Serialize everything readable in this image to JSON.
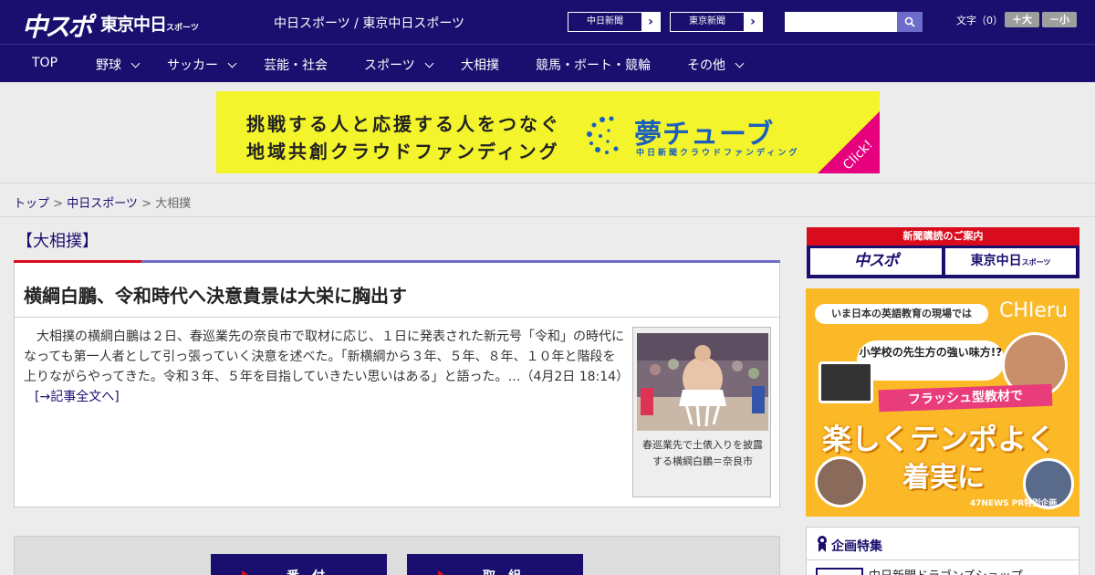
{
  "header": {
    "logo_chuspo": "中スポ",
    "logo_tokyo": "東京中日",
    "logo_tokyo_small": "スポーツ",
    "site_links": "中日スポーツ / 東京中日スポーツ",
    "paper_buttons": [
      "中日新聞",
      "東京新聞"
    ],
    "search_placeholder": "",
    "font_size_label": "文字（0）",
    "font_plus": "＋大",
    "font_minus": "－小"
  },
  "nav": {
    "items": [
      {
        "label": "TOP"
      },
      {
        "label": "野球"
      },
      {
        "label": "サッカー"
      },
      {
        "label": "芸能・社会"
      },
      {
        "label": "スポーツ"
      },
      {
        "label": "大相撲"
      },
      {
        "label": "競馬・ボート・競輪"
      },
      {
        "label": "その他"
      }
    ]
  },
  "banner": {
    "line1": "挑戦する人と応援する人をつなぐ",
    "line2": "地域共創クラウドファンディング",
    "brand": "夢チューブ",
    "brand_sub": "中日新聞クラウドファンディング",
    "click": "Click!"
  },
  "breadcrumb": {
    "home": "トップ",
    "sep": " > ",
    "parent": "中日スポーツ",
    "current": "大相撲"
  },
  "section": {
    "title": "【大相撲】"
  },
  "article": {
    "title": "横綱白鵬、令和時代へ決意貴景は大栄に胸出す",
    "body": "　大相撲の横綱白鵬は２日、春巡業先の奈良市で取材に応じ、１日に発表された新元号「令和」の時代になっても第一人者として引っ張っていく決意を述べた。「新横綱から３年、５年、８年、１０年と階段を上りながらやってきた。令和３年、５年を目指していきたい思いはある」と語った。…（4月2日 18:14）",
    "more": "[→記事全文へ]",
    "photo_caption": "春巡業先で土俵入りを披露する横綱白鵬＝奈良市"
  },
  "bottom_buttons": [
    "番付",
    "取組"
  ],
  "sidebar": {
    "subscribe_header": "新聞購読のご案内",
    "subscribe_1": "中スポ",
    "subscribe_2": "東京中日",
    "subscribe_2_small": "スポーツ",
    "ad": {
      "band": "いま日本の英語教育の現場では",
      "logo": "CHIeru",
      "question": "小学校の先生方の強い味方!?",
      "flash": "フラッシュ型教材で",
      "big1": "楽しくテンポよく",
      "big2": "着実に",
      "pr": "47NEWS PR特別企画"
    },
    "feature_title": "企画特集",
    "feature_item": "中日新聞ドラゴンズショップ"
  }
}
